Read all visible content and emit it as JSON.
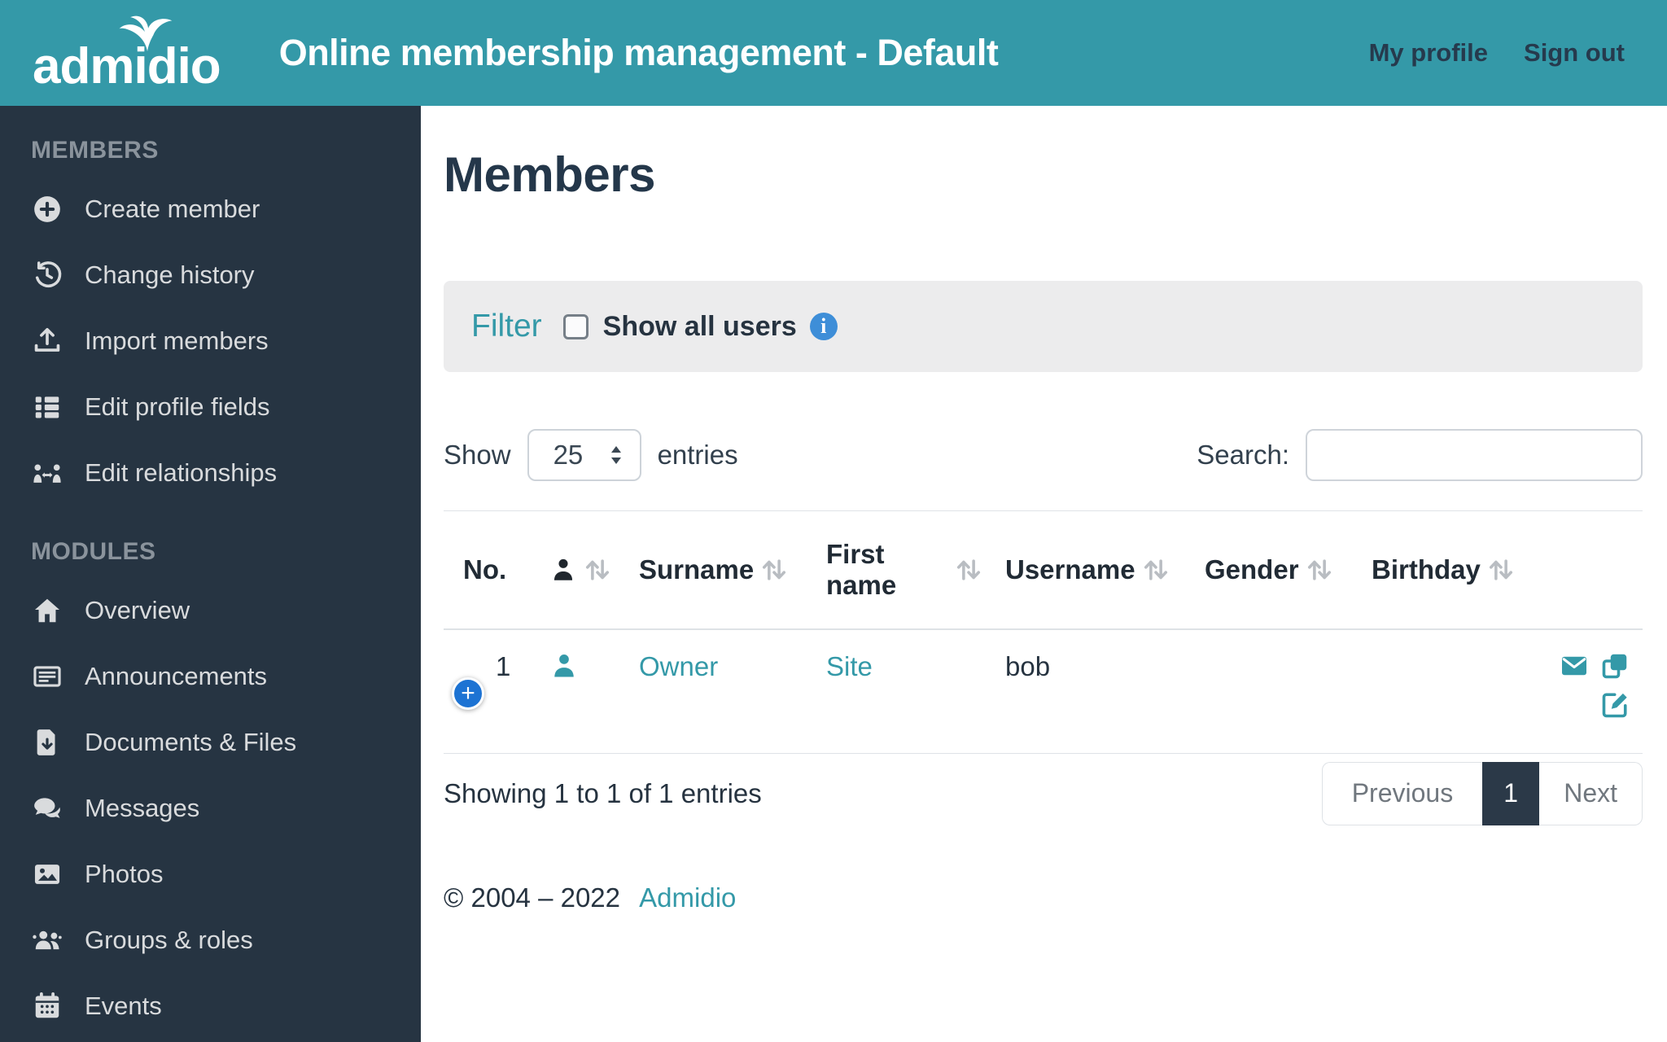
{
  "colors": {
    "header_bg": "#3499A8",
    "sidebar_bg": "#263442",
    "accent_teal": "#3499A8",
    "dark_text": "#263340",
    "info_blue": "#3E8ED8",
    "expand_blue": "#1D73D3",
    "pagination_active_bg": "#2B3948"
  },
  "header": {
    "logo_text": "admidio",
    "title": "Online membership management - Default",
    "nav": [
      {
        "label": "My profile"
      },
      {
        "label": "Sign out"
      }
    ]
  },
  "sidebar": {
    "sections": [
      {
        "heading": "MEMBERS",
        "items": [
          {
            "label": "Create member",
            "icon": "plus-circle-icon"
          },
          {
            "label": "Change history",
            "icon": "history-icon"
          },
          {
            "label": "Import members",
            "icon": "upload-icon"
          },
          {
            "label": "Edit profile fields",
            "icon": "list-icon"
          },
          {
            "label": "Edit relationships",
            "icon": "relationships-icon"
          }
        ]
      },
      {
        "heading": "MODULES",
        "items": [
          {
            "label": "Overview",
            "icon": "home-icon"
          },
          {
            "label": "Announcements",
            "icon": "newspaper-icon"
          },
          {
            "label": "Documents & Files",
            "icon": "file-download-icon"
          },
          {
            "label": "Messages",
            "icon": "messages-icon"
          },
          {
            "label": "Photos",
            "icon": "photo-icon"
          },
          {
            "label": "Groups & roles",
            "icon": "groups-icon"
          },
          {
            "label": "Events",
            "icon": "calendar-icon"
          }
        ]
      }
    ]
  },
  "main": {
    "page_title": "Members",
    "filter": {
      "label": "Filter",
      "checkbox_label": "Show all users",
      "checkbox_checked": false,
      "info_icon": "info-icon"
    },
    "length_control": {
      "prefix": "Show",
      "selected": "25",
      "suffix": "entries"
    },
    "search": {
      "label": "Search:",
      "value": ""
    },
    "table": {
      "columns": [
        {
          "label": "No.",
          "sortable": false
        },
        {
          "label": "",
          "icon": "person-icon",
          "sortable": true
        },
        {
          "label": "Surname",
          "sortable": true
        },
        {
          "label": "First name",
          "sortable": true
        },
        {
          "label": "Username",
          "sortable": true
        },
        {
          "label": "Gender",
          "sortable": true
        },
        {
          "label": "Birthday",
          "sortable": true
        },
        {
          "label": "",
          "sortable": false
        }
      ],
      "rows": [
        {
          "no": "1",
          "surname": "Owner",
          "first_name": "Site",
          "username": "bob",
          "gender": "",
          "birthday": "",
          "actions": [
            "message-icon",
            "copy-icon",
            "edit-icon"
          ]
        }
      ]
    },
    "info_text": "Showing 1 to 1 of 1 entries",
    "pagination": {
      "previous": "Previous",
      "pages": [
        "1"
      ],
      "active": "1",
      "next": "Next"
    },
    "footer": {
      "copyright": "© 2004 – 2022",
      "link_label": "Admidio"
    }
  }
}
